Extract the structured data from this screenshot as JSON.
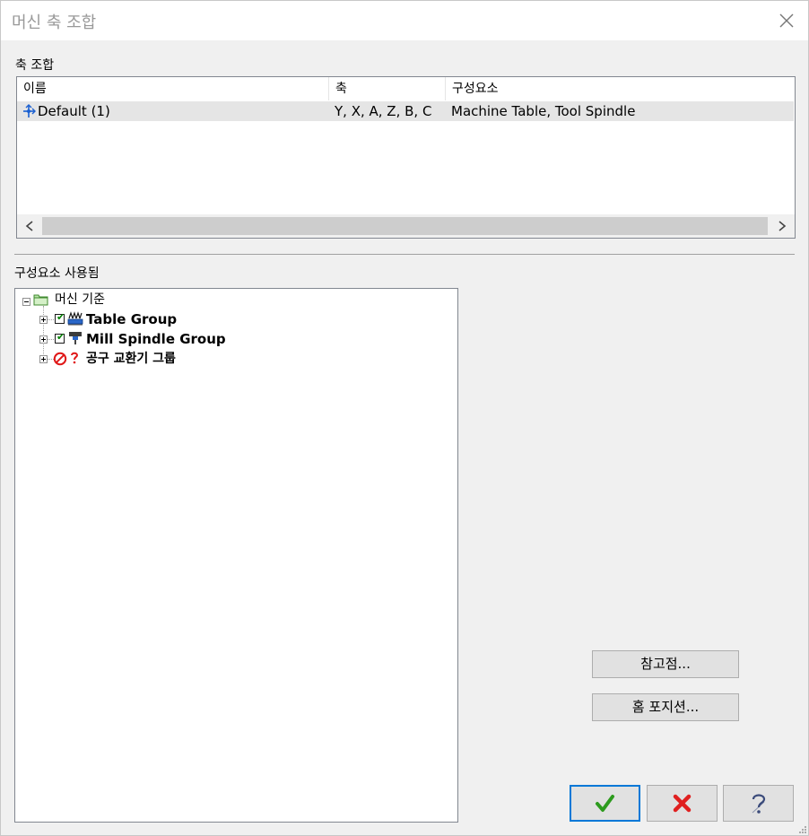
{
  "window": {
    "title": "머신 축 조합",
    "close_icon": "close-icon"
  },
  "axis_combinations": {
    "label": "축 조합",
    "columns": [
      "이름",
      "축",
      "구성요소"
    ],
    "rows": [
      {
        "icon": "axis-combination-icon",
        "name": "Default (1)",
        "axes": "Y, X, A, Z, B, C",
        "components": "Machine Table, Tool Spindle"
      }
    ],
    "scroll_left": "<",
    "scroll_right": ">"
  },
  "components_used": {
    "label": "구성요소 사용됨",
    "root": {
      "label": "머신 기준",
      "icon": "folder-icon",
      "expanded": true
    },
    "children": [
      {
        "label": "Table Group",
        "checked": true,
        "icon": "table-group-icon",
        "bold": true
      },
      {
        "label": "Mill Spindle Group",
        "checked": true,
        "icon": "spindle-group-icon",
        "bold": true
      },
      {
        "label": "공구 교환기 그룹",
        "checked": false,
        "icon": "not-allowed-icon",
        "status_icon": "question-icon",
        "bold": true
      }
    ]
  },
  "buttons": {
    "reference_point": "참고점...",
    "home_position": "홈 포지션...",
    "ok_icon": "checkmark-icon",
    "cancel_icon": "x-icon",
    "help_icon": "help-icon"
  },
  "colors": {
    "ok_green": "#2d9b1e",
    "cancel_red": "#e02020",
    "focus_blue": "#0078d7"
  }
}
